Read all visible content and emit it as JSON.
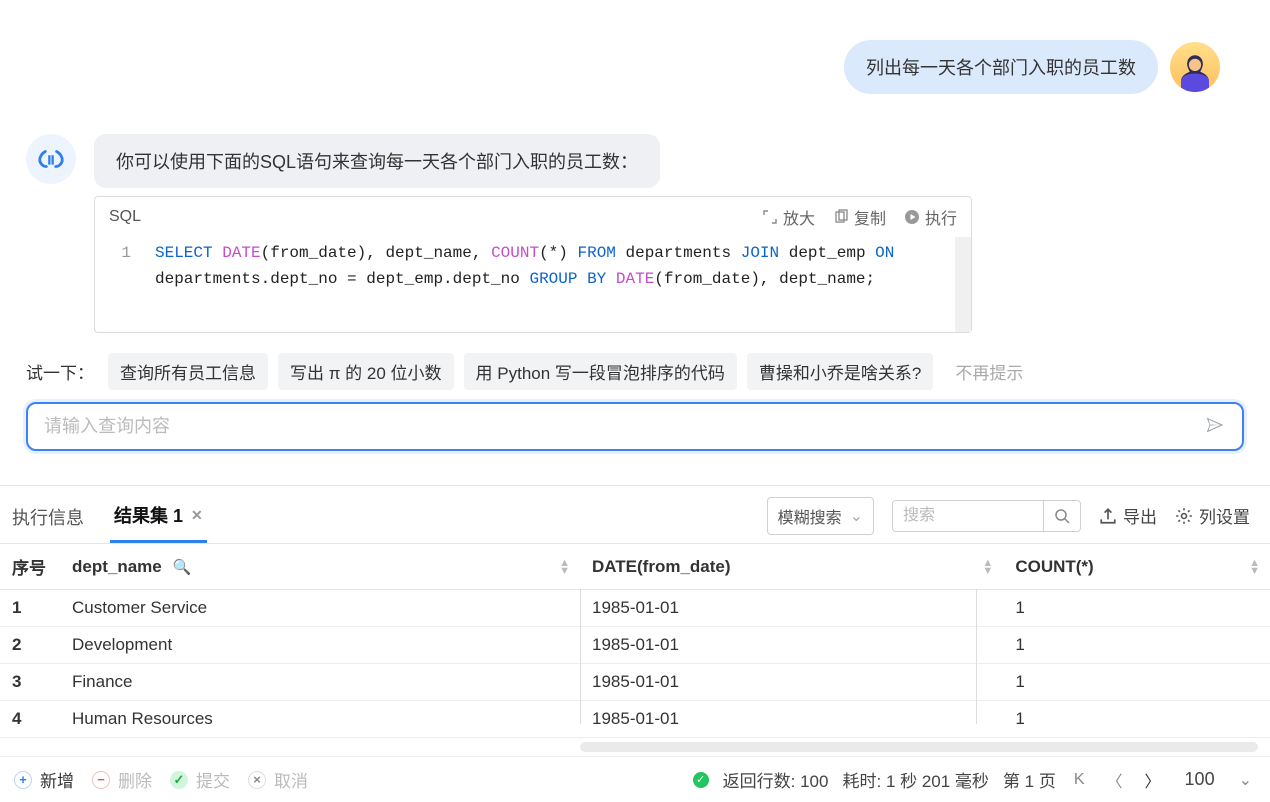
{
  "chat": {
    "user_message": "列出每一天各个部门入职的员工数",
    "assistant_message": "你可以使用下面的SQL语句来查询每一天各个部门入职的员工数：",
    "code_lang": "SQL",
    "code_actions": {
      "expand": "放大",
      "copy": "复制",
      "run": "执行"
    },
    "code_line_num": "1"
  },
  "sql": {
    "p1_kw": "SELECT ",
    "p2_fn": "DATE",
    "p3_plain": "(from_date), dept_name, ",
    "p4_fn": "COUNT",
    "p5_plain": "(*) ",
    "p6_kw": "FROM",
    "p7_plain": " departments ",
    "p8_kw": "JOIN",
    "p9_plain": " dept_emp ",
    "p10_kw": "ON",
    "p11_plain": " departments.dept_no = dept_emp.dept_no ",
    "p12_kw": "GROUP BY",
    "p13_plain": " ",
    "p14_fn": "DATE",
    "p15_plain": "(from_date), dept_name;"
  },
  "try": {
    "label": "试一下：",
    "chips": [
      "查询所有员工信息",
      "写出 π 的 20 位小数",
      "用 Python 写一段冒泡排序的代码",
      "曹操和小乔是啥关系?"
    ],
    "dismiss": "不再提示"
  },
  "input": {
    "placeholder": "请输入查询内容"
  },
  "tabs": {
    "exec_info": "执行信息",
    "resultset": "结果集 1"
  },
  "toolbar": {
    "fuzzy": "模糊搜索",
    "search_ph": "搜索",
    "export": "导出",
    "columns": "列设置"
  },
  "table": {
    "headers": {
      "serial": "序号",
      "dept": "dept_name",
      "date": "DATE(from_date)",
      "count": "COUNT(*)"
    },
    "rows": [
      {
        "n": "1",
        "dept": "Customer Service",
        "date": "1985-01-01",
        "count": "1"
      },
      {
        "n": "2",
        "dept": "Development",
        "date": "1985-01-01",
        "count": "1"
      },
      {
        "n": "3",
        "dept": "Finance",
        "date": "1985-01-01",
        "count": "1"
      },
      {
        "n": "4",
        "dept": "Human Resources",
        "date": "1985-01-01",
        "count": "1"
      }
    ]
  },
  "footer": {
    "add": "新增",
    "delete": "删除",
    "commit": "提交",
    "cancel": "取消",
    "rows_label": "返回行数:",
    "rows_value": "100",
    "time_label": "耗时:",
    "time_value": "1 秒 201 毫秒",
    "page_label": "第 1 页",
    "page_size": "100"
  }
}
